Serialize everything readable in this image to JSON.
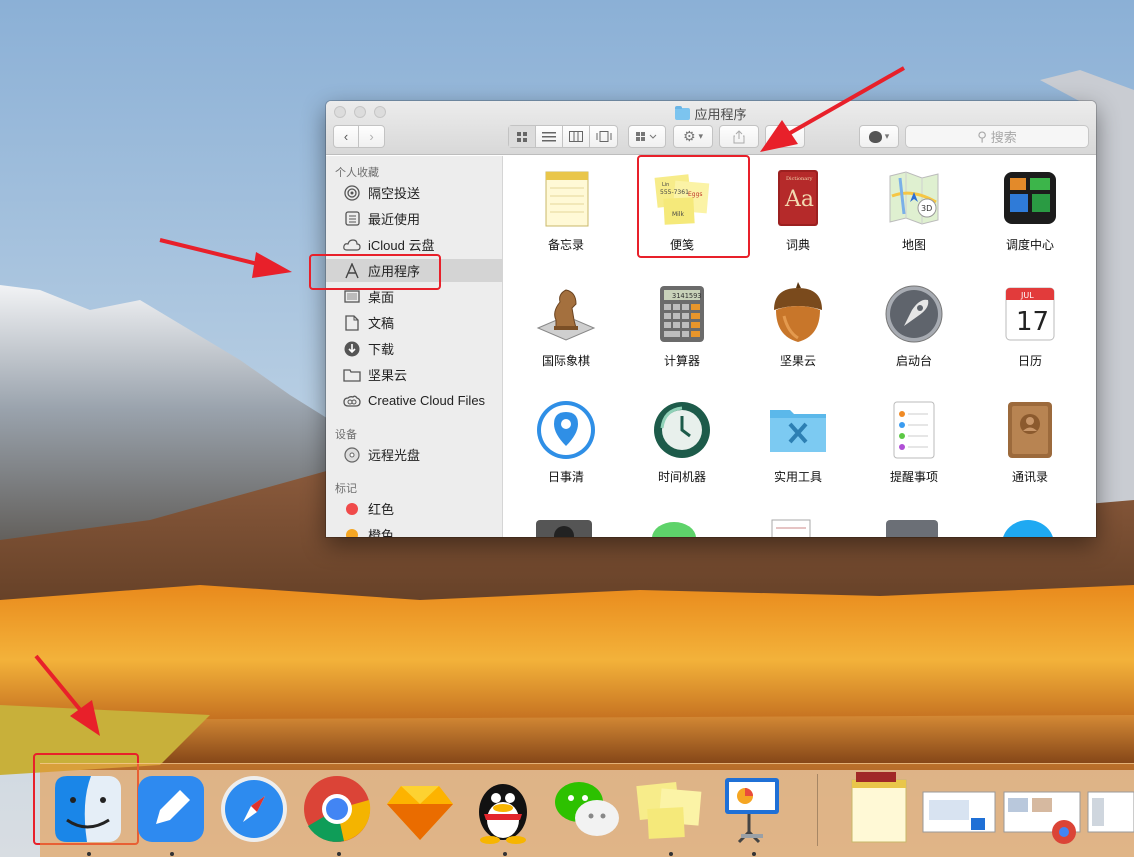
{
  "window": {
    "title": "应用程序",
    "search_placeholder": "搜索"
  },
  "sidebar": {
    "favorites_heading": "个人收藏",
    "favorites": [
      {
        "label": "隔空投送",
        "icon": "airdrop-icon"
      },
      {
        "label": "最近使用",
        "icon": "recents-icon"
      },
      {
        "label": "iCloud 云盘",
        "icon": "icloud-icon"
      },
      {
        "label": "应用程序",
        "icon": "applications-icon",
        "selected": true
      },
      {
        "label": "桌面",
        "icon": "desktop-icon"
      },
      {
        "label": "文稿",
        "icon": "documents-icon"
      },
      {
        "label": "下载",
        "icon": "downloads-icon"
      },
      {
        "label": "坚果云",
        "icon": "folder-icon"
      },
      {
        "label": "Creative Cloud Files",
        "icon": "creative-cloud-icon"
      }
    ],
    "devices_heading": "设备",
    "devices": [
      {
        "label": "远程光盘",
        "icon": "remote-disc-icon"
      }
    ],
    "tags_heading": "标记",
    "tags": [
      {
        "label": "红色",
        "color": "#f04a4a"
      },
      {
        "label": "橙色",
        "color": "#f5a623"
      }
    ]
  },
  "apps": [
    {
      "label": "备忘录",
      "icon": "notes-icon"
    },
    {
      "label": "便笺",
      "icon": "stickies-icon",
      "note_lines": [
        "Lin",
        "555-7361",
        "Eggs",
        "Milk"
      ]
    },
    {
      "label": "词典",
      "icon": "dictionary-icon",
      "glyph": "Aa",
      "cover_text": "Dictionary"
    },
    {
      "label": "地图",
      "icon": "maps-icon",
      "badge": "3D"
    },
    {
      "label": "调度中心",
      "icon": "mission-control-icon"
    },
    {
      "label": "国际象棋",
      "icon": "chess-icon"
    },
    {
      "label": "计算器",
      "icon": "calculator-icon",
      "display": "3141593"
    },
    {
      "label": "坚果云",
      "icon": "nutstore-icon"
    },
    {
      "label": "启动台",
      "icon": "launchpad-icon"
    },
    {
      "label": "日历",
      "icon": "calendar-icon",
      "month": "JUL",
      "day": "17"
    },
    {
      "label": "日事清",
      "icon": "rishiqing-icon"
    },
    {
      "label": "时间机器",
      "icon": "time-machine-icon"
    },
    {
      "label": "实用工具",
      "icon": "utilities-folder-icon"
    },
    {
      "label": "提醒事项",
      "icon": "reminders-icon"
    },
    {
      "label": "通讯录",
      "icon": "contacts-icon"
    }
  ],
  "dock": [
    {
      "name": "finder-icon",
      "running": true
    },
    {
      "name": "pen-app-icon",
      "running": true
    },
    {
      "name": "safari-icon",
      "running": false
    },
    {
      "name": "chrome-icon",
      "running": true
    },
    {
      "name": "sketch-icon",
      "running": false
    },
    {
      "name": "qq-icon",
      "running": true
    },
    {
      "name": "wechat-icon",
      "running": false
    },
    {
      "name": "stickies-icon",
      "running": true
    },
    {
      "name": "keynote-icon",
      "running": true
    }
  ],
  "colors": {
    "annotation_red": "#e8202a",
    "sidebar_bg": "#ededed",
    "selected_row": "#d4d4d4"
  }
}
